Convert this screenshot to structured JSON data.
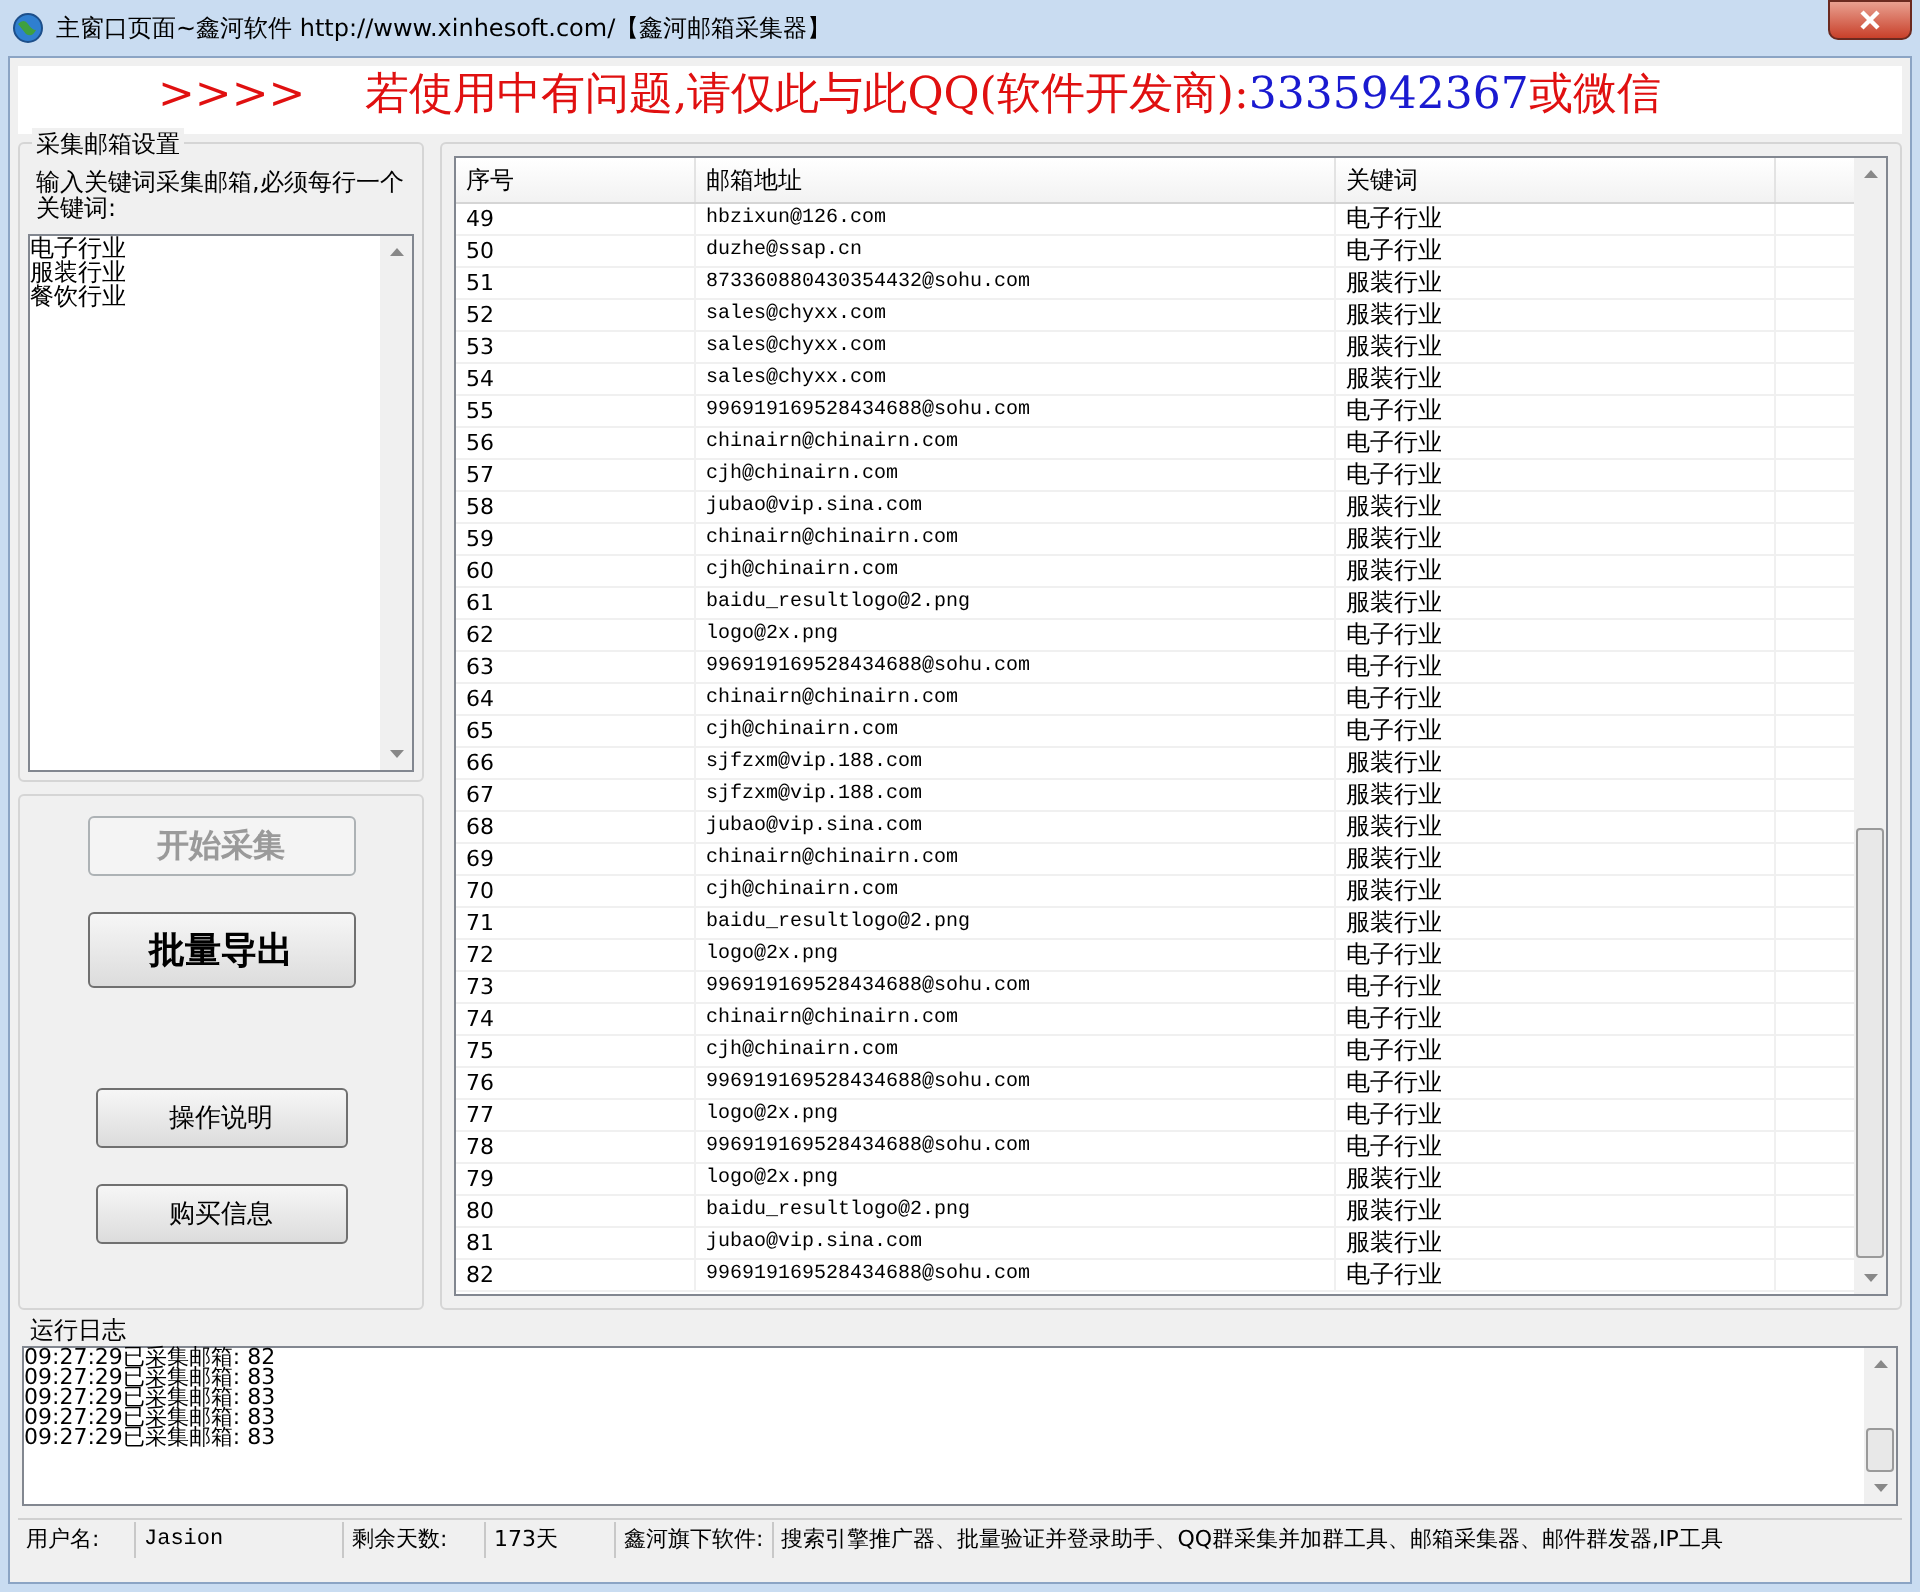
{
  "window": {
    "title": "主窗口页面~鑫河软件 http://www.xinhesoft.com/【鑫河邮箱采集器】"
  },
  "banner": [
    {
      "text": ">>>>",
      "color": "#e01010"
    },
    {
      "text": "若使用中有问题,请仅此与此QQ(软件开发商):",
      "color": "#e01010"
    },
    {
      "text": "3335942367",
      "color": "#1a1ad0"
    },
    {
      "text": "或微信",
      "color": "#e01010"
    }
  ],
  "settings": {
    "group_title": "采集邮箱设置",
    "instruction": "输入关键词采集邮箱,必须每行一个关键词:",
    "keywords": [
      "电子行业",
      "服装行业",
      "餐饮行业"
    ]
  },
  "buttons": [
    {
      "label": "开始采集",
      "kind": "large",
      "disabled": true
    },
    {
      "label": "批量导出",
      "kind": "large",
      "disabled": false
    },
    {
      "label": "操作说明",
      "kind": "small",
      "disabled": false
    },
    {
      "label": "购买信息",
      "kind": "small",
      "disabled": false
    }
  ],
  "table": {
    "columns": [
      "序号",
      "邮箱地址",
      "关键词"
    ],
    "rows": [
      [
        "49",
        "hbzixun@126.com",
        "电子行业"
      ],
      [
        "50",
        "duzhe@ssap.cn",
        "电子行业"
      ],
      [
        "51",
        "873360880430354432@sohu.com",
        "服装行业"
      ],
      [
        "52",
        "sales@chyxx.com",
        "服装行业"
      ],
      [
        "53",
        "sales@chyxx.com",
        "服装行业"
      ],
      [
        "54",
        "sales@chyxx.com",
        "服装行业"
      ],
      [
        "55",
        "996919169528434688@sohu.com",
        "电子行业"
      ],
      [
        "56",
        "chinairn@chinairn.com",
        "电子行业"
      ],
      [
        "57",
        "cjh@chinairn.com",
        "电子行业"
      ],
      [
        "58",
        "jubao@vip.sina.com",
        "服装行业"
      ],
      [
        "59",
        "chinairn@chinairn.com",
        "服装行业"
      ],
      [
        "60",
        "cjh@chinairn.com",
        "服装行业"
      ],
      [
        "61",
        "baidu_resultlogo@2.png",
        "服装行业"
      ],
      [
        "62",
        "logo@2x.png",
        "电子行业"
      ],
      [
        "63",
        "996919169528434688@sohu.com",
        "电子行业"
      ],
      [
        "64",
        "chinairn@chinairn.com",
        "电子行业"
      ],
      [
        "65",
        "cjh@chinairn.com",
        "电子行业"
      ],
      [
        "66",
        "sjfzxm@vip.188.com",
        "服装行业"
      ],
      [
        "67",
        "sjfzxm@vip.188.com",
        "服装行业"
      ],
      [
        "68",
        "jubao@vip.sina.com",
        "服装行业"
      ],
      [
        "69",
        "chinairn@chinairn.com",
        "服装行业"
      ],
      [
        "70",
        "cjh@chinairn.com",
        "服装行业"
      ],
      [
        "71",
        "baidu_resultlogo@2.png",
        "服装行业"
      ],
      [
        "72",
        "logo@2x.png",
        "电子行业"
      ],
      [
        "73",
        "996919169528434688@sohu.com",
        "电子行业"
      ],
      [
        "74",
        "chinairn@chinairn.com",
        "电子行业"
      ],
      [
        "75",
        "cjh@chinairn.com",
        "电子行业"
      ],
      [
        "76",
        "996919169528434688@sohu.com",
        "电子行业"
      ],
      [
        "77",
        "logo@2x.png",
        "电子行业"
      ],
      [
        "78",
        "996919169528434688@sohu.com",
        "电子行业"
      ],
      [
        "79",
        "logo@2x.png",
        "服装行业"
      ],
      [
        "80",
        "baidu_resultlogo@2.png",
        "服装行业"
      ],
      [
        "81",
        "jubao@vip.sina.com",
        "服装行业"
      ],
      [
        "82",
        "996919169528434688@sohu.com",
        "电子行业"
      ]
    ]
  },
  "log": {
    "title": "运行日志",
    "lines": [
      "09:27:29已采集邮箱: 82",
      "09:27:29已采集邮箱: 83",
      "09:27:29已采集邮箱: 83",
      "09:27:29已采集邮箱: 83",
      "09:27:29已采集邮箱: 83"
    ]
  },
  "status_bar": [
    {
      "label": "用户名:",
      "value": "Jasion"
    },
    {
      "label": "剩余天数:",
      "value": "173天"
    },
    {
      "label": "鑫河旗下软件:",
      "value": "搜索引擎推广器、批量验证并登录助手、QQ群采集并加群工具、邮箱采集器、邮件群发器,IP工具"
    }
  ]
}
